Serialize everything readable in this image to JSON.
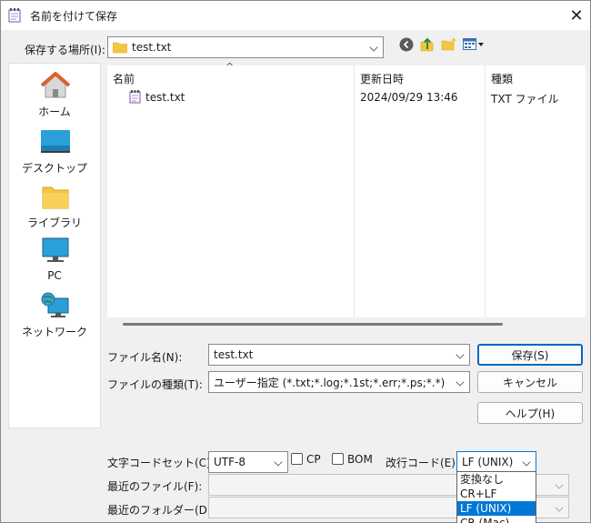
{
  "window": {
    "title": "名前を付けて保存",
    "close_symbol": "✕"
  },
  "location": {
    "label": "保存する場所(I):",
    "value": "test.txt"
  },
  "toolbar": {
    "back_icon": "back-arrow-icon",
    "up_icon": "up-folder-icon",
    "new_folder_icon": "new-folder-icon",
    "view_menu_icon": "view-menu-icon"
  },
  "places": [
    {
      "label": "ホーム",
      "icon": "home-icon"
    },
    {
      "label": "デスクトップ",
      "icon": "desktop-icon"
    },
    {
      "label": "ライブラリ",
      "icon": "library-icon"
    },
    {
      "label": "PC",
      "icon": "pc-icon"
    },
    {
      "label": "ネットワーク",
      "icon": "network-icon"
    }
  ],
  "file_list": {
    "sort_indicator": "^",
    "columns": [
      "名前",
      "更新日時",
      "種類"
    ],
    "rows": [
      {
        "name": "test.txt",
        "modified": "2024/09/29 13:46",
        "type": "TXT ファイル"
      }
    ]
  },
  "form": {
    "filename_label": "ファイル名(N):",
    "filename_value": "test.txt",
    "filetype_label": "ファイルの種類(T):",
    "filetype_value": "ユーザー指定 (*.txt;*.log;*.1st;*.err;*.ps;*.*)",
    "charset_label": "文字コードセット(C):",
    "charset_value": "UTF-8",
    "cp_label": "CP",
    "bom_label": "BOM",
    "newline_label": "改行コード(E):",
    "newline_value": "LF (UNIX)",
    "recent_files_label": "最近のファイル(F):",
    "recent_folders_label": "最近のフォルダー(D):"
  },
  "buttons": {
    "save": "保存(S)",
    "cancel": "キャンセル",
    "help": "ヘルプ(H)"
  },
  "newline_options": [
    {
      "label": "変換なし",
      "selected": false
    },
    {
      "label": "CR+LF",
      "selected": false
    },
    {
      "label": "LF (UNIX)",
      "selected": true
    },
    {
      "label": "CR (Mac)",
      "selected": false
    }
  ],
  "colors": {
    "accent": "#0078d7",
    "folder": "#f5c542",
    "home_roof": "#e0602a"
  }
}
